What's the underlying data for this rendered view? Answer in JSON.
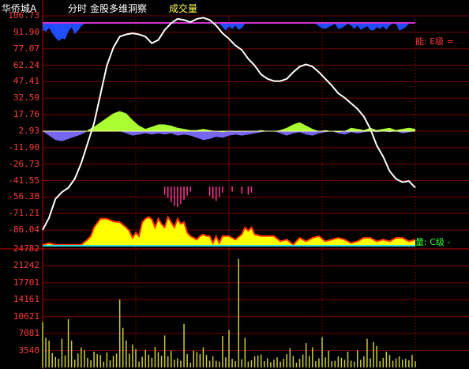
{
  "header": {
    "stock_name": "华侨城A",
    "mode": "分时",
    "indicator": "金股多维洞察",
    "volume_title": "成交量"
  },
  "right_labels": {
    "energy": "能: E级 =",
    "volume": "量: C级 -"
  },
  "colors": {
    "background": "#000000",
    "axis_red": "#ff3b3b",
    "price_line": "#ffffff",
    "top_bar": "#cc33cc",
    "blue_area": "#1f4dff",
    "green_area": "#aaff33",
    "purple_area": "#7766ee",
    "yellow_area": "#ffff00",
    "magenta_ticks": "#ff3399",
    "volume_bar": "#cccc33",
    "cyan_line": "#33dddd"
  },
  "chart_data": {
    "type": "line",
    "upper_axis": {
      "ylim": [
        -100.9,
        106.73
      ],
      "ticks": [
        "106.73",
        "91.90",
        "77.07",
        "62.24",
        "47.41",
        "32.59",
        "17.76",
        "2.93",
        "-11.90",
        "-26.73",
        "-41.55",
        "-56.38",
        "-71.21",
        "-86.04"
      ],
      "tick_values": [
        106.73,
        91.9,
        77.07,
        62.24,
        47.41,
        32.59,
        17.76,
        2.93,
        -11.9,
        -26.73,
        -41.55,
        -56.38,
        -71.21,
        -86.04
      ]
    },
    "volume_axis": {
      "ylim": [
        0,
        24782
      ],
      "ticks": [
        "24782",
        "21242",
        "17701",
        "14161",
        "10621",
        "7081",
        "3540"
      ],
      "tick_values": [
        24782,
        21242,
        17701,
        14161,
        10621,
        7081,
        3540
      ]
    },
    "price_line": {
      "name": "",
      "x": [
        0,
        2,
        4,
        6,
        8,
        10,
        12,
        14,
        16,
        18,
        20,
        22,
        24,
        26,
        28,
        30,
        32,
        34,
        36,
        38,
        40,
        42,
        44,
        46,
        48,
        50,
        52,
        54,
        56,
        58,
        60,
        62,
        64,
        66,
        68,
        70,
        72,
        74,
        76,
        78,
        80,
        82,
        84,
        86,
        88,
        90,
        92,
        94,
        96,
        98,
        100,
        102,
        104,
        106,
        108,
        110,
        112,
        114,
        116
      ],
      "y": [
        -86,
        -75,
        -58,
        -52,
        -48,
        -40,
        -26,
        -8,
        10,
        36,
        62,
        78,
        88,
        90,
        91,
        90,
        88,
        82,
        85,
        94,
        100,
        104,
        103,
        101,
        104,
        105,
        103,
        98,
        91,
        86,
        80,
        76,
        68,
        62,
        54,
        50,
        48,
        48,
        50,
        56,
        61,
        63,
        61,
        56,
        50,
        44,
        37,
        33,
        28,
        23,
        16,
        5,
        -10,
        -20,
        -33,
        -40,
        -43,
        -42,
        -48,
        -44
      ]
    },
    "green_area": {
      "x": [
        14,
        16,
        18,
        20,
        22,
        24,
        26,
        28,
        30,
        32,
        34,
        36,
        38,
        40,
        42,
        44,
        46,
        48,
        50,
        52,
        54,
        56,
        58,
        60,
        62,
        64,
        66,
        68,
        70,
        72,
        74,
        76,
        78,
        80,
        82,
        84,
        86,
        88,
        90,
        92,
        94,
        96,
        98,
        100,
        102,
        104,
        106,
        108,
        110,
        112,
        114,
        116
      ],
      "y": [
        1,
        4,
        8,
        12,
        16,
        18,
        16,
        10,
        5,
        2,
        4,
        6,
        6,
        5,
        3,
        2,
        1,
        1,
        2,
        1,
        0,
        -1,
        0,
        0,
        0,
        0,
        0,
        1,
        0,
        0,
        1,
        3,
        6,
        8,
        5,
        2,
        0,
        1,
        0,
        -1,
        0,
        3,
        2,
        1,
        3,
        1,
        2,
        3,
        1,
        2,
        3,
        2
      ]
    },
    "purple_area": {
      "x": [
        0,
        2,
        4,
        6,
        8,
        10,
        12,
        14,
        16,
        18,
        20,
        22,
        24,
        26,
        28,
        30,
        32,
        34,
        36,
        38,
        40,
        42,
        44,
        46,
        48,
        50,
        52,
        54,
        56,
        58,
        60,
        62,
        64,
        66,
        68,
        70,
        72,
        74,
        76,
        78,
        80,
        82,
        84,
        86,
        88,
        90,
        92,
        94,
        96,
        98,
        100,
        102,
        104,
        106,
        108,
        110,
        112,
        114,
        116
      ],
      "y": [
        0,
        -4,
        -8,
        -9,
        -7,
        -5,
        -3,
        0,
        0,
        0,
        0,
        0,
        0,
        -2,
        -4,
        -3,
        -2,
        -3,
        -2,
        -3,
        -2,
        -4,
        -3,
        -4,
        -6,
        -8,
        -7,
        -5,
        -6,
        -4,
        -3,
        -4,
        -3,
        -2,
        -1,
        0,
        0,
        -2,
        -4,
        -2,
        -1,
        -3,
        -4,
        -2,
        -1,
        0,
        -2,
        -3,
        -1,
        -2,
        -1,
        0,
        -1,
        0,
        -1,
        0,
        -2,
        -1,
        0
      ]
    },
    "blue_top_area": {
      "x": [
        0,
        1,
        2,
        3,
        4,
        5,
        6,
        7,
        8,
        9,
        10,
        11,
        12,
        13,
        14,
        15,
        16,
        17,
        18,
        19,
        20,
        21,
        22,
        23,
        24,
        25,
        26,
        27,
        28,
        29,
        30,
        31,
        32,
        33,
        34,
        35,
        36,
        37,
        38,
        39,
        40,
        41,
        42,
        43,
        44,
        45,
        46,
        47,
        48,
        49,
        50,
        51,
        52,
        53,
        54,
        55,
        56,
        57,
        58,
        59,
        60,
        61,
        62,
        63,
        64,
        65,
        66,
        67,
        68,
        69,
        70,
        71,
        72,
        73,
        74,
        75,
        76,
        77,
        78,
        79,
        80,
        81,
        82,
        83,
        84,
        85,
        86,
        87,
        88,
        89,
        90,
        91,
        92,
        93,
        94,
        95,
        96,
        97,
        98,
        99,
        100,
        101,
        102,
        103,
        104,
        105,
        106,
        107,
        108,
        109,
        110,
        111,
        112,
        113,
        114,
        115,
        116
      ],
      "depth": [
        0.35,
        0.45,
        0.25,
        0.55,
        0.8,
        1.0,
        0.85,
        0.9,
        0.45,
        0.2,
        0.6,
        0.4,
        0.15,
        0,
        0,
        0,
        0,
        0,
        0,
        0,
        0,
        0,
        0,
        0,
        0,
        0,
        0,
        0,
        0,
        0,
        0,
        0,
        0,
        0,
        0,
        0,
        0,
        0,
        0,
        0,
        0,
        0,
        0,
        0,
        0,
        0,
        0,
        0,
        0,
        0,
        0,
        0,
        0,
        0,
        0,
        0,
        0.2,
        0.4,
        0.15,
        0.3,
        0.1,
        0.35,
        0.25,
        0,
        0,
        0,
        0,
        0,
        0,
        0,
        0,
        0,
        0,
        0,
        0,
        0,
        0,
        0,
        0,
        0,
        0,
        0,
        0,
        0,
        0,
        0,
        0.15,
        0.25,
        0.3,
        0.2,
        0.1,
        0,
        0.3,
        0.25,
        0.15,
        0,
        0.1,
        0.3,
        0.1,
        0.35,
        0.25,
        0.15,
        0.35,
        0.4,
        0.2,
        0.3,
        0.15,
        0.35,
        0.1,
        0,
        0,
        0.4,
        0.3,
        0.2,
        0,
        0,
        0
      ]
    },
    "yellow_area": {
      "x": [
        0,
        2,
        4,
        6,
        8,
        10,
        12,
        14,
        15,
        16,
        18,
        20,
        22,
        24,
        26,
        27,
        28,
        29,
        30,
        31,
        32,
        33,
        34,
        35,
        36,
        37,
        38,
        39,
        40,
        41,
        42,
        43,
        44,
        45,
        46,
        47,
        48,
        49,
        50,
        51,
        52,
        53,
        54,
        55,
        56,
        58,
        60,
        62,
        63,
        64,
        65,
        66,
        68,
        70,
        72,
        74,
        76,
        78,
        80,
        82,
        84,
        86,
        88,
        90,
        92,
        94,
        96,
        98,
        100,
        102,
        104,
        106,
        108,
        110,
        112,
        114,
        116
      ],
      "y": [
        0.05,
        0.1,
        0.05,
        0.05,
        0.05,
        0.05,
        0.05,
        0.2,
        0.3,
        0.55,
        0.8,
        0.8,
        0.72,
        0.7,
        0.55,
        0.45,
        0.25,
        0.4,
        0.3,
        0.7,
        0.8,
        0.85,
        0.78,
        0.55,
        0.8,
        0.65,
        0.55,
        0.85,
        0.7,
        0.55,
        0.8,
        0.65,
        0.7,
        0.4,
        0.3,
        0.25,
        0.2,
        0.3,
        0.35,
        0.3,
        0.3,
        0.1,
        0.3,
        0.1,
        0.3,
        0.3,
        0.2,
        0.35,
        0.55,
        0.45,
        0.55,
        0.35,
        0.3,
        0.3,
        0.3,
        0.15,
        0.2,
        0.05,
        0.25,
        0.15,
        0.25,
        0.3,
        0.15,
        0.2,
        0.25,
        0.2,
        0.1,
        0.15,
        0.25,
        0.25,
        0.15,
        0.2,
        0.15,
        0.25,
        0.25,
        0.15,
        0.2
      ]
    },
    "magenta_ticks": {
      "x": [
        38,
        39,
        40,
        41,
        42,
        43,
        44,
        45,
        46,
        52,
        53,
        54,
        55,
        56,
        59,
        62,
        64,
        65
      ],
      "len": [
        0.4,
        0.55,
        0.75,
        0.95,
        1.0,
        0.85,
        0.65,
        0.45,
        0.25,
        0.45,
        0.6,
        0.7,
        0.5,
        0.3,
        0.25,
        0.35,
        0.4,
        0.3
      ]
    },
    "volume_bars": {
      "x": [
        0,
        1,
        2,
        3,
        4,
        5,
        6,
        7,
        8,
        9,
        10,
        11,
        12,
        13,
        14,
        15,
        16,
        17,
        18,
        19,
        20,
        21,
        22,
        23,
        24,
        25,
        26,
        27,
        28,
        29,
        30,
        31,
        32,
        33,
        34,
        35,
        36,
        37,
        38,
        39,
        40,
        41,
        42,
        43,
        44,
        45,
        46,
        47,
        48,
        49,
        50,
        51,
        52,
        53,
        54,
        55,
        56,
        57,
        58,
        59,
        60,
        61,
        62,
        63,
        64,
        65,
        66,
        67,
        68,
        69,
        70,
        71,
        72,
        73,
        74,
        75,
        76,
        77,
        78,
        79,
        80,
        81,
        82,
        83,
        84,
        85,
        86,
        87,
        88,
        89,
        90,
        91,
        92,
        93,
        94,
        95,
        96,
        97,
        98,
        99,
        100,
        101,
        102,
        103,
        104,
        105,
        106,
        107,
        108,
        109,
        110,
        111,
        112,
        113,
        114,
        115,
        116
      ],
      "values": [
        9500,
        6200,
        5600,
        3000,
        2200,
        1800,
        6000,
        2500,
        10100,
        5600,
        1600,
        2900,
        4200,
        3600,
        2000,
        1500,
        3300,
        2800,
        2600,
        1200,
        3100,
        1500,
        2400,
        2900,
        14200,
        8300,
        5600,
        2900,
        4800,
        3800,
        1200,
        2200,
        3700,
        2700,
        2000,
        4300,
        3200,
        2400,
        6700,
        2300,
        3500,
        1600,
        1900,
        1400,
        9100,
        2800,
        1000,
        3500,
        3200,
        2800,
        4200,
        2600,
        1400,
        2300,
        1400,
        1200,
        6600,
        2100,
        7800,
        1800,
        1300,
        22700,
        1700,
        6200,
        1200,
        1500,
        2300,
        2500,
        2700,
        1300,
        1900,
        1100,
        1600,
        2100,
        1200,
        1800,
        2800,
        4000,
        2400,
        1000,
        1800,
        2700,
        5100,
        2400,
        4200,
        1300,
        1900,
        6300,
        2100,
        3500,
        1300,
        1400,
        2300,
        2000,
        1600,
        3300,
        1400,
        1200,
        3600,
        1600,
        2300,
        6000,
        1900,
        5300,
        4500,
        1300,
        2000,
        3300,
        2600,
        1400,
        1900,
        2300,
        1600,
        1800,
        1500,
        2600,
        1300
      ]
    }
  }
}
